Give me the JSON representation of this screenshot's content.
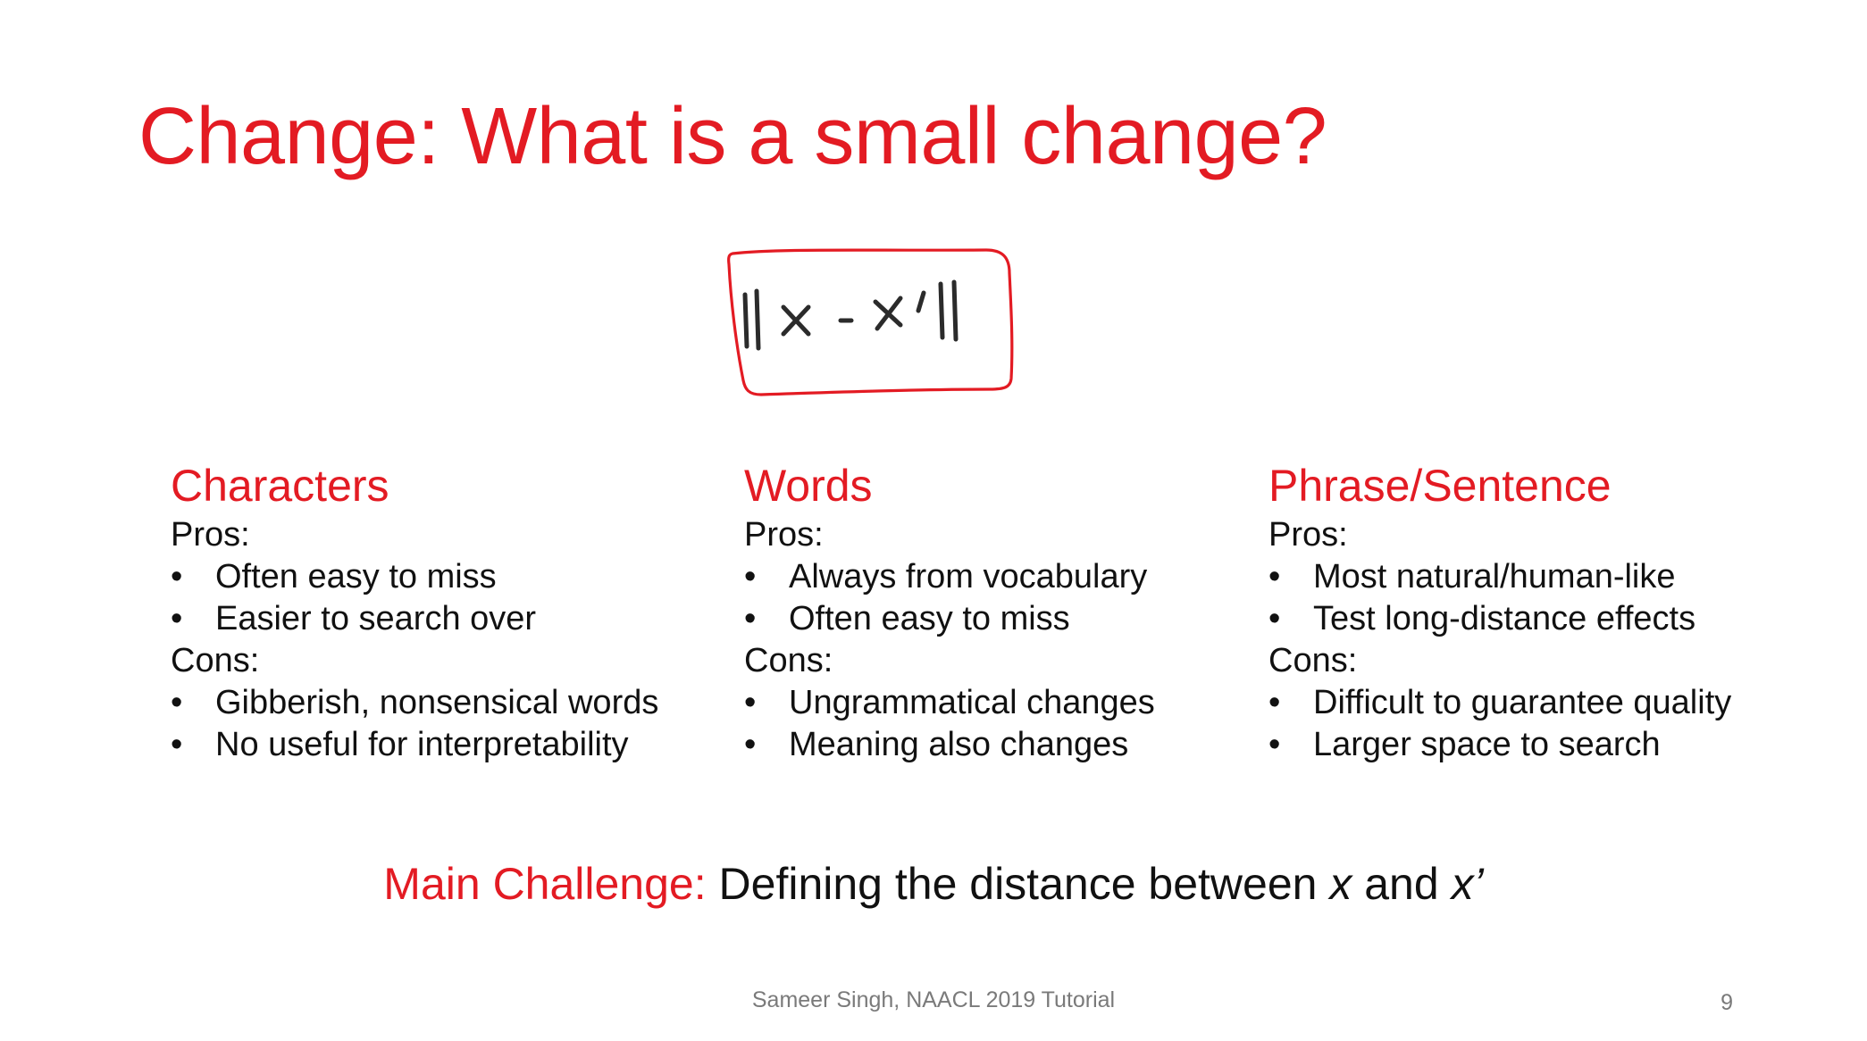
{
  "title": "Change: What is a small change?",
  "formula": {
    "text": "||x - x’||",
    "annotation_color": "#e31b23"
  },
  "columns": [
    {
      "heading": "Characters",
      "pros_label": "Pros:",
      "pros": [
        "Often easy to miss",
        "Easier to search over"
      ],
      "cons_label": "Cons:",
      "cons": [
        "Gibberish, nonsensical words",
        "No useful for interpretability"
      ]
    },
    {
      "heading": "Words",
      "pros_label": "Pros:",
      "pros": [
        "Always from vocabulary",
        "Often easy to miss"
      ],
      "cons_label": "Cons:",
      "cons": [
        "Ungrammatical changes",
        "Meaning also changes"
      ]
    },
    {
      "heading": "Phrase/Sentence",
      "pros_label": "Pros:",
      "pros": [
        "Most natural/human-like",
        "Test long-distance effects"
      ],
      "cons_label": "Cons:",
      "cons": [
        "Difficult to guarantee quality",
        "Larger space to search"
      ]
    }
  ],
  "challenge": {
    "label": "Main Challenge:",
    "text_before": "Defining the distance between",
    "var1": "x",
    "and": "and",
    "var2": "x’"
  },
  "footer": "Sameer Singh, NAACL 2019 Tutorial",
  "page_number": "9",
  "colors": {
    "accent": "#e31b23",
    "body_text": "#111111",
    "footer_text": "#7a7a7a"
  }
}
